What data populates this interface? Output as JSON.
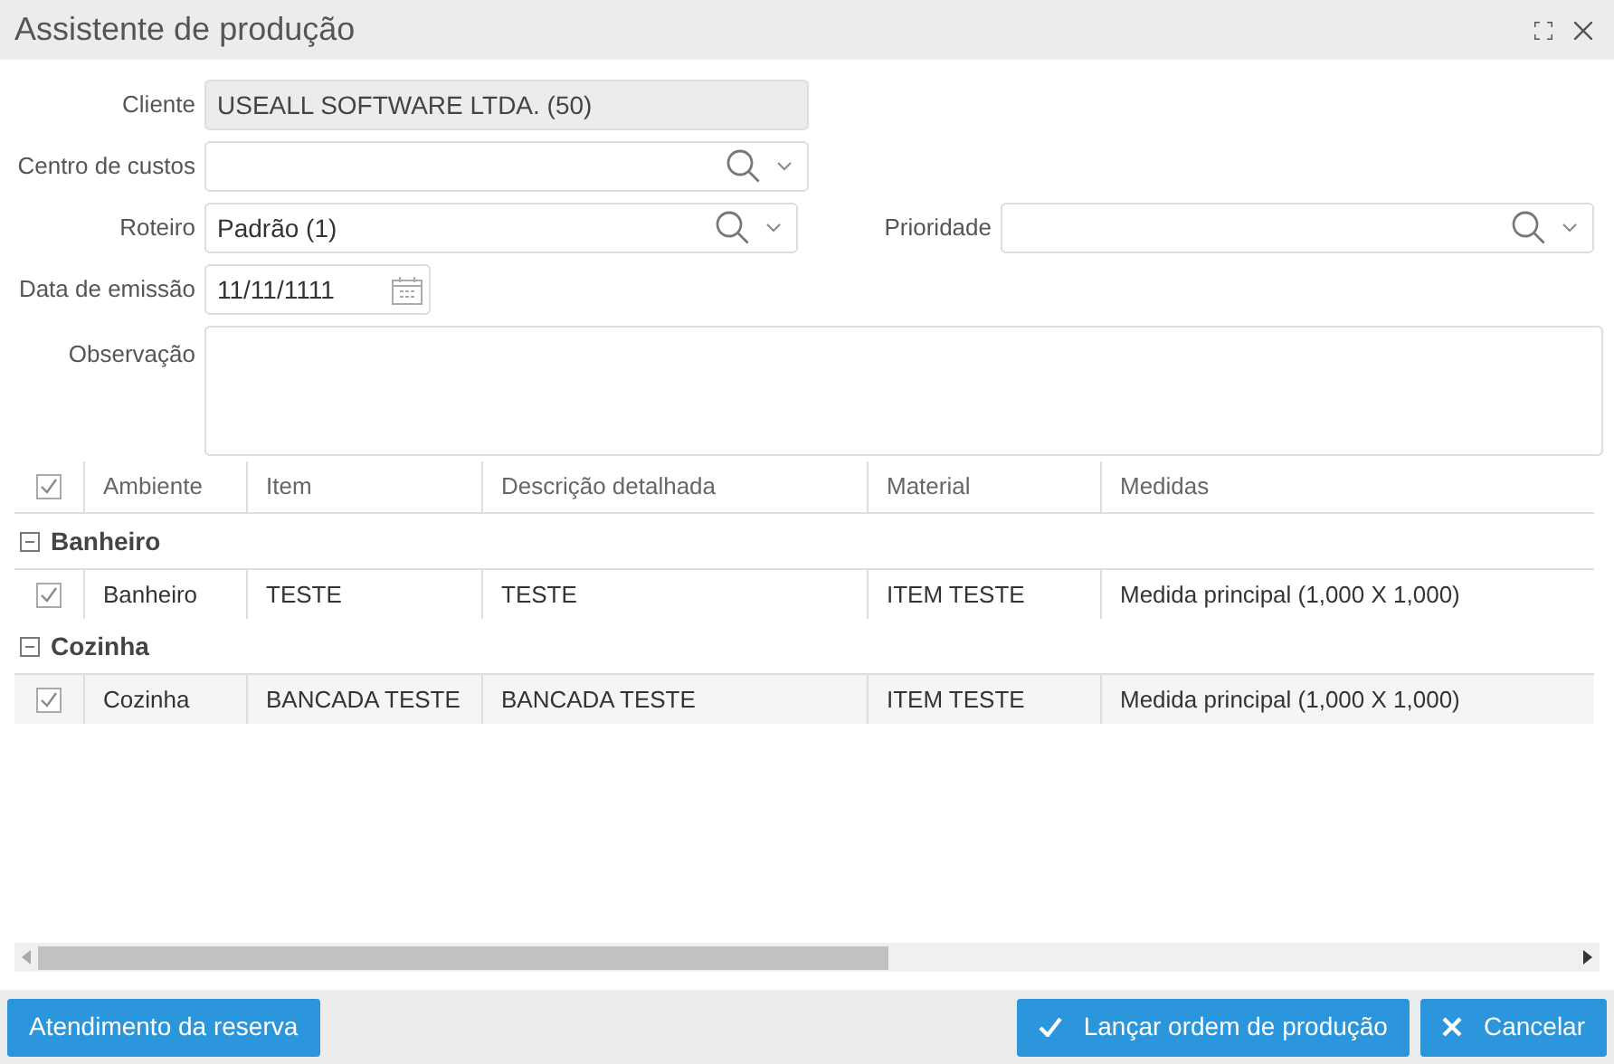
{
  "window": {
    "title": "Assistente de produção"
  },
  "form": {
    "cliente": {
      "label": "Cliente",
      "value": "USEALL SOFTWARE LTDA. (50)",
      "disabled": true
    },
    "centro_de_custos": {
      "label": "Centro de custos"
    },
    "roteiro": {
      "label": "Roteiro",
      "value": "Padrão (1)"
    },
    "prioridade": {
      "label": "Prioridade"
    },
    "data_de_emissao": {
      "label": "Data de emissão",
      "value": "11/11/1111"
    },
    "observacao": {
      "label": "Observação"
    }
  },
  "table": {
    "header_checked": true,
    "columns": [
      "Ambiente",
      "Item",
      "Descrição detalhada",
      "Material",
      "Medidas"
    ],
    "groups": [
      {
        "title": "Banheiro",
        "expanded": true,
        "rows": [
          {
            "checked": true,
            "cells": [
              "Banheiro",
              "TESTE",
              "TESTE",
              "ITEM TESTE",
              "Medida principal (1,000 X 1,000)"
            ]
          }
        ]
      },
      {
        "title": "Cozinha",
        "expanded": true,
        "rows": [
          {
            "checked": true,
            "cells": [
              "Cozinha",
              "BANCADA TESTE",
              "BANCADA TESTE",
              "ITEM TESTE",
              "Medida principal (1,000 X 1,000)"
            ]
          }
        ]
      }
    ]
  },
  "buttons": {
    "left": [
      {
        "label": "Atendimento da reserva"
      }
    ],
    "right": [
      {
        "label": "Lançar ordem de produção",
        "kind": "check"
      },
      {
        "label": "Cancelar",
        "kind": "close"
      }
    ]
  }
}
